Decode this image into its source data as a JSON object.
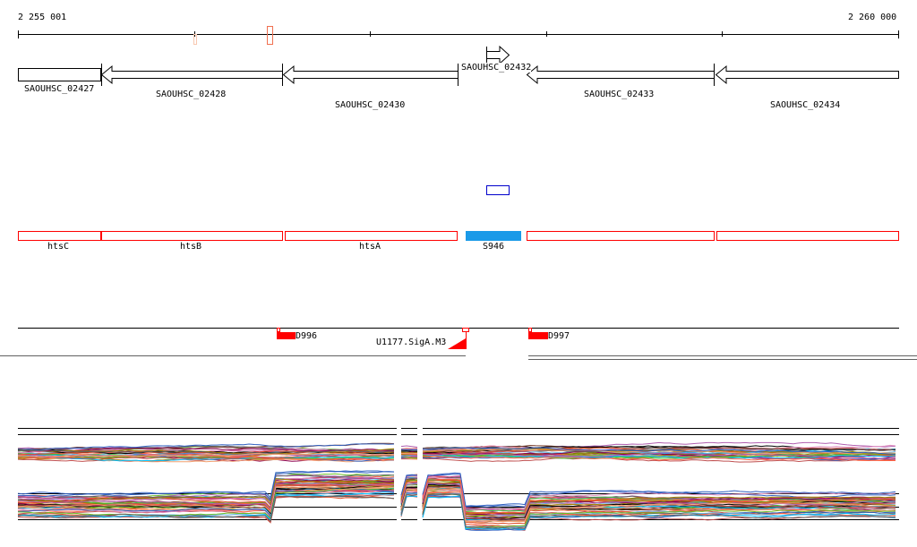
{
  "ruler": {
    "start_label": "2 255 001",
    "end_label": "2 260 000"
  },
  "genes": [
    {
      "id": "SAOUHSC_02427",
      "strand": "none"
    },
    {
      "id": "SAOUHSC_02428",
      "strand": "-"
    },
    {
      "id": "SAOUHSC_02430",
      "strand": "-"
    },
    {
      "id": "SAOUHSC_02432",
      "strand": "+"
    },
    {
      "id": "SAOUHSC_02433",
      "strand": "-"
    },
    {
      "id": "SAOUHSC_02434",
      "strand": "-"
    }
  ],
  "features": [
    {
      "label": "htsC"
    },
    {
      "label": "htsB"
    },
    {
      "label": "htsA"
    },
    {
      "label": "S946",
      "color": "#1a9ae8"
    },
    {
      "label": ""
    },
    {
      "label": ""
    }
  ],
  "sites": [
    {
      "label": "D996"
    },
    {
      "label": "U1177.SigA.M3"
    },
    {
      "label": "D997"
    }
  ],
  "colors": {
    "feature_outline": "#ff0000",
    "site_fill": "#ff0000",
    "accent_blue": "#1a9ae8",
    "outline_blue": "#0000cc",
    "trace_palette": [
      "#000000",
      "#e0502a",
      "#8b0050",
      "#6bbf2a",
      "#00bfff",
      "#a08000",
      "#c05050",
      "#ff6040",
      "#b060b0",
      "#606060",
      "#f0a070",
      "#3060c0",
      "#c04080",
      "#808000",
      "#40c040",
      "#7a4030",
      "#60b0e0",
      "#e090c0"
    ]
  }
}
